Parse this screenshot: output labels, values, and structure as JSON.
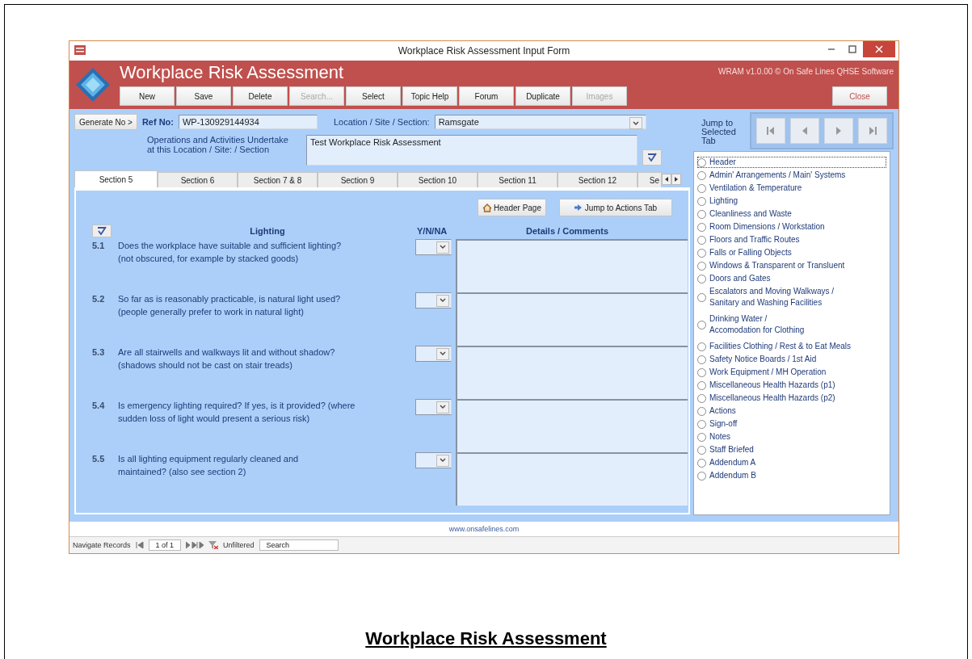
{
  "window": {
    "title": "Workplace Risk Assessment Input Form"
  },
  "header": {
    "title": "Workplace Risk Assessment",
    "version": "WRAM v1.0.00 © On Safe Lines QHSE Software",
    "close_button": "Close"
  },
  "toolbar": [
    {
      "label": "New",
      "disabled": false
    },
    {
      "label": "Save",
      "disabled": false
    },
    {
      "label": "Delete",
      "disabled": false
    },
    {
      "label": "Search...",
      "disabled": true
    },
    {
      "label": "Select",
      "disabled": false
    },
    {
      "label": "Topic Help",
      "disabled": false
    },
    {
      "label": "Forum",
      "disabled": false
    },
    {
      "label": "Duplicate",
      "disabled": false
    },
    {
      "label": "Images",
      "disabled": true
    }
  ],
  "form": {
    "generate_button": "Generate No >",
    "ref_label": "Ref No:",
    "ref_value": "WP-130929144934",
    "location_label": "Location / Site / Section:",
    "location_value": "Ramsgate",
    "operations_label": "Operations and Activities Undertake\nat this Location / Site: / Section",
    "operations_value": "Test Workplace Risk Assessment"
  },
  "jump_label": "Jump to\nSelected\nTab",
  "tabs": [
    {
      "label": "Section 5",
      "selected": true
    },
    {
      "label": "Section 6",
      "selected": false
    },
    {
      "label": "Section 7 & 8",
      "selected": false
    },
    {
      "label": "Section 9",
      "selected": false
    },
    {
      "label": "Section 10",
      "selected": false
    },
    {
      "label": "Section 11",
      "selected": false
    },
    {
      "label": "Section 12",
      "selected": false
    },
    {
      "label": "Se",
      "selected": false
    }
  ],
  "section": {
    "header_page_button": "Header Page",
    "jump_actions_button": "Jump to Actions Tab",
    "heading": "Lighting",
    "yn_heading": "Y/N/NA",
    "details_heading": "Details / Comments",
    "questions": [
      {
        "number": "5.1",
        "text": "Does the workplace have suitable and sufficient lighting?\n(not obscured, for example by stacked goods)"
      },
      {
        "number": "5.2",
        "text": "So far as is reasonably practicable, is natural light used?\n(people generally prefer to work in natural light)"
      },
      {
        "number": "5.3",
        "text": "Are all stairwells and walkways lit and without shadow?\n(shadows should not be cast on stair treads)"
      },
      {
        "number": "5.4",
        "text": "Is emergency lighting required? If yes, is it provided? (where\nsudden loss of light would present a serious risk)"
      },
      {
        "number": "5.5",
        "text": "Is all lighting equipment regularly cleaned and\nmaintained? (also see section 2)"
      }
    ]
  },
  "jump_list": [
    {
      "label": "Header",
      "selected": false,
      "focused": true
    },
    {
      "label": "Admin' Arrangements / Main' Systems",
      "selected": false,
      "focused": false
    },
    {
      "label": "Ventilation & Temperature",
      "selected": false,
      "focused": false
    },
    {
      "label": "Lighting",
      "selected": false,
      "focused": false
    },
    {
      "label": "Cleanliness and Waste",
      "selected": false,
      "focused": false
    },
    {
      "label": "Room Dimensions / Workstation",
      "selected": false,
      "focused": false
    },
    {
      "label": "Floors and Traffic Routes",
      "selected": false,
      "focused": false
    },
    {
      "label": "Falls or Falling Objects",
      "selected": false,
      "focused": false
    },
    {
      "label": "Windows & Transparent or Transluent",
      "selected": false,
      "focused": false
    },
    {
      "label": "Doors and Gates",
      "selected": false,
      "focused": false
    },
    {
      "label": "Escalators and Moving Walkways /\nSanitary and Washing Facilities",
      "selected": false,
      "focused": false
    },
    {
      "label": "Drinking Water /\nAccomodation for Clothing",
      "selected": false,
      "focused": false
    },
    {
      "label": "Facilities Clothing / Rest & to Eat Meals",
      "selected": false,
      "focused": false
    },
    {
      "label": "Safety Notice Boards / 1st Aid",
      "selected": false,
      "focused": false
    },
    {
      "label": "Work Equipment / MH Operation",
      "selected": false,
      "focused": false
    },
    {
      "label": "Miscellaneous Health Hazards (p1)",
      "selected": false,
      "focused": false
    },
    {
      "label": "Miscellaneous Health Hazards (p2)",
      "selected": false,
      "focused": false
    },
    {
      "label": "Actions",
      "selected": false,
      "focused": false
    },
    {
      "label": "Sign-off",
      "selected": false,
      "focused": false
    },
    {
      "label": "Notes",
      "selected": false,
      "focused": false
    },
    {
      "label": "Staff Briefed",
      "selected": false,
      "focused": false
    },
    {
      "label": "Addendum A",
      "selected": false,
      "focused": false
    },
    {
      "label": "Addendum B",
      "selected": false,
      "focused": false
    }
  ],
  "footer_url": "www.onsafelines.com",
  "status_bar": {
    "navigate_label": "Navigate Records",
    "record": "1 of 1",
    "filter": "Unfiltered",
    "search": "Search"
  },
  "caption": "Workplace Risk Assessment"
}
